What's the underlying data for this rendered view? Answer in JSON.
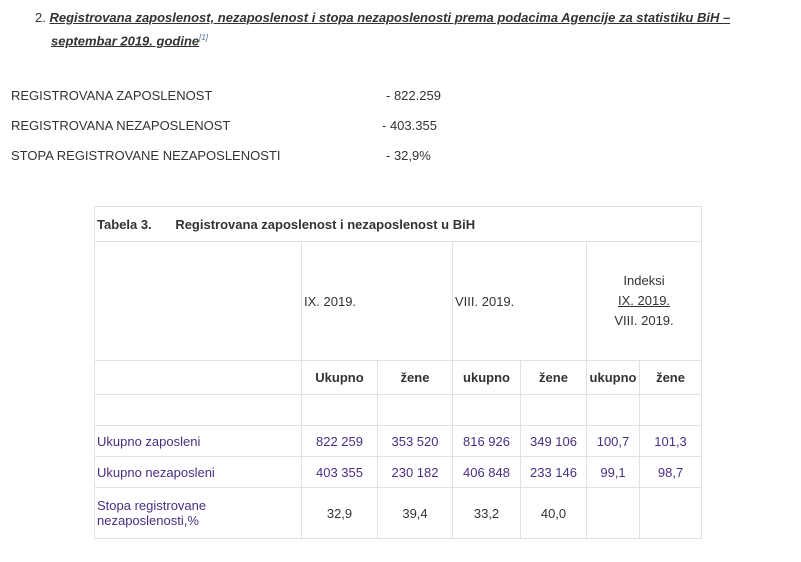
{
  "heading": {
    "number": "2.",
    "title_line1": "Registrovana zaposlenost, nezaposlenost i stopa nezaposlenosti prema podacima Agencije za statistiku BiH –",
    "title_line2": "septembar 2019. godine",
    "footnote": "[1]"
  },
  "stats": [
    {
      "label": "REGISTROVANA ZAPOSLENOST",
      "value": "-  822.259"
    },
    {
      "label": "REGISTROVANA NEZAPOSLENOST",
      "value": "-  403.355"
    },
    {
      "label": "STOPA REGISTROVANE NEZAPOSLENOSTI",
      "value": "- 32,9%"
    }
  ],
  "table": {
    "caption_num": "Tabela 3.",
    "caption_title": "Registrovana zaposlenost i nezaposlenost u BiH",
    "period1": "IX. 2019.",
    "period2": "VIII. 2019.",
    "index_label": "Indeksi",
    "index_num": "IX. 2019.",
    "index_den": "VIII. 2019.",
    "sub_headers": [
      "Ukupno",
      "žene",
      "ukupno",
      "žene",
      "ukupno",
      "žene"
    ],
    "rows": [
      {
        "label": "Ukupno zaposleni",
        "values": [
          "822 259",
          "353 520",
          "816 926",
          "349 106",
          "100,7",
          "101,3"
        ]
      },
      {
        "label": "Ukupno nezaposleni",
        "values": [
          "403 355",
          "230 182",
          "406 848",
          "233 146",
          "99,1",
          "98,7"
        ]
      },
      {
        "label": "Stopa registrovane nezaposlenosti,%",
        "values": [
          "32,9",
          "39,4",
          "33,2",
          "40,0",
          "",
          ""
        ]
      }
    ]
  }
}
